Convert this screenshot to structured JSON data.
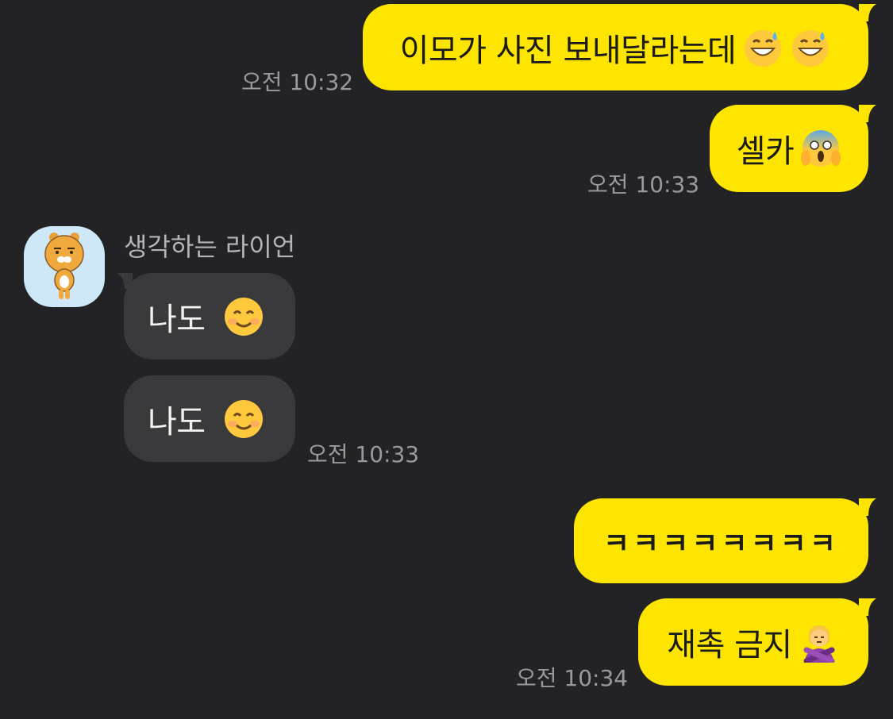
{
  "messages": {
    "m1": {
      "text": "이모가 사진 보내달라는데",
      "emoji": [
        "sweat-smile-icon",
        "sweat-smile-icon"
      ],
      "time": "오전 10:32"
    },
    "m2": {
      "text": "셀카",
      "emoji": [
        "scream-face-icon"
      ],
      "time": "오전 10:33"
    },
    "m3": {
      "sender": "생각하는 라이언",
      "text": "나도",
      "emoji": [
        "smiling-face-icon"
      ]
    },
    "m4": {
      "text": "나도",
      "emoji": [
        "smiling-face-icon"
      ],
      "time": "오전 10:33"
    },
    "m5": {
      "text": "ㅋㅋㅋㅋㅋㅋㅋㅋ"
    },
    "m6": {
      "text": "재촉 금지",
      "emoji": [
        "person-gesturing-no-icon"
      ],
      "time": "오전 10:34"
    }
  },
  "colors": {
    "background": "#232325",
    "my_bubble": "#FEE500",
    "other_bubble": "#3a3a3c",
    "timestamp": "#9a9a9c"
  }
}
